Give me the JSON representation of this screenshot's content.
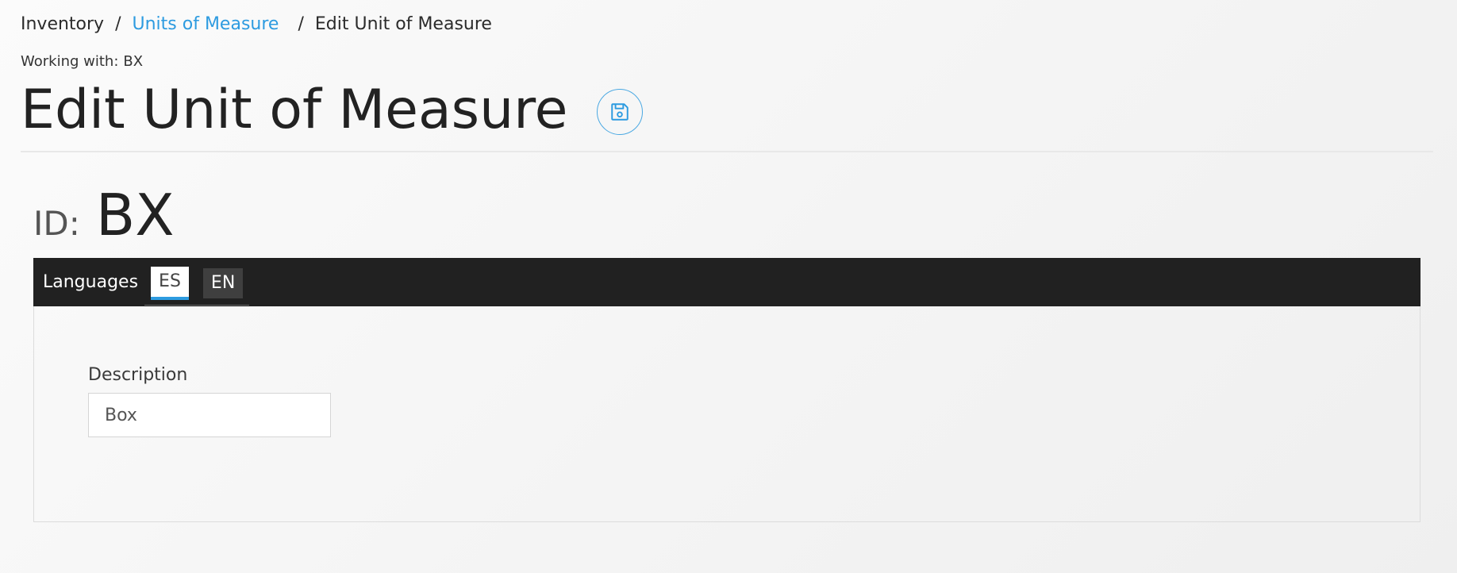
{
  "breadcrumb": {
    "root": "Inventory",
    "separator": "/",
    "parent": "Units of Measure",
    "current": "Edit Unit of Measure"
  },
  "working_with": {
    "label": "Working with:",
    "value": "BX"
  },
  "page": {
    "title": "Edit Unit of Measure",
    "save_icon": "save-disk-icon"
  },
  "record": {
    "id_label": "ID:",
    "id_value": "BX"
  },
  "languages": {
    "label": "Languages",
    "tabs": [
      {
        "code": "ES",
        "active": true
      },
      {
        "code": "EN",
        "active": false
      }
    ]
  },
  "form": {
    "description_label": "Description",
    "description_value": "Box"
  },
  "colors": {
    "accent": "#2d9be0",
    "dark_bar": "#212121"
  }
}
